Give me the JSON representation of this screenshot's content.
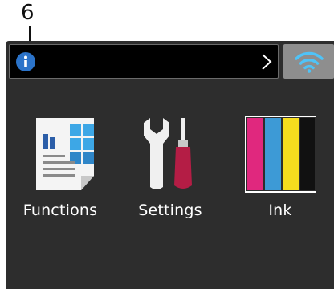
{
  "callout": {
    "number": "6"
  },
  "status_bar": {
    "info_icon": "info-icon",
    "arrow_icon": "chevron-right-icon"
  },
  "wifi": {
    "icon": "wifi-icon",
    "color": "#4fc3f7"
  },
  "menu": {
    "items": [
      {
        "label": "Functions",
        "icon": "functions-icon"
      },
      {
        "label": "Settings",
        "icon": "settings-icon"
      },
      {
        "label": "Ink",
        "icon": "ink-icon"
      }
    ]
  },
  "colors": {
    "screen_bg": "#2d2d2d",
    "status_bg": "#000000",
    "info_blue": "#2b73c9",
    "wifi_bg": "#8e8e8e",
    "ink_magenta": "#e0287e",
    "ink_cyan": "#3d9ad6",
    "ink_yellow": "#f5dc1e",
    "ink_black": "#111111"
  }
}
